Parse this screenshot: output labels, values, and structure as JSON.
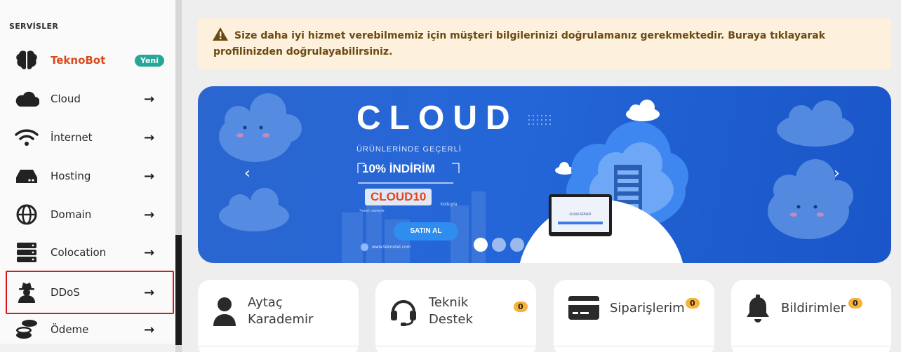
{
  "sidebar": {
    "section_title": "SERVİSLER",
    "items": [
      {
        "label": "TeknoBot",
        "badge": "Yeni",
        "icon": "brain-icon"
      },
      {
        "label": "Cloud",
        "icon": "cloud-icon"
      },
      {
        "label": "İnternet",
        "icon": "wifi-icon"
      },
      {
        "label": "Hosting",
        "icon": "server-drive-icon"
      },
      {
        "label": "Domain",
        "icon": "globe-icon"
      },
      {
        "label": "Colocation",
        "icon": "server-rack-icon"
      },
      {
        "label": "DDoS",
        "icon": "user-secret-icon"
      },
      {
        "label": "Ödeme",
        "icon": "coins-icon"
      }
    ],
    "arrow": "→"
  },
  "alert": {
    "icon": "warning-icon",
    "text": "Size daha iyi hizmet verebilmemiz için müşteri bilgilerinizi doğrulamanız gerekmektedir. Buraya tıklayarak profilinizden doğrulayabilirsiniz."
  },
  "banner": {
    "title": "CLOUD",
    "subtitle": "ÜRÜNLERİNDE GEÇERLİ",
    "discount": "10% İNDİRİM",
    "code": "CLOUD10",
    "code_note": "koduyla",
    "small_note": "*sınırlı süreyle",
    "button": "SATIN AL",
    "site": "www.teknotel.com",
    "laptop_text": "CLOUD SERVER",
    "prev": "‹",
    "next": "›"
  },
  "cards": [
    {
      "title_line1": "Aytaç",
      "title_line2": "Karademir",
      "icon": "user-icon"
    },
    {
      "title_line1": "Teknik",
      "title_line2": "Destek",
      "count": "0",
      "icon": "headset-icon"
    },
    {
      "title_line1": "Siparişlerim",
      "count": "0",
      "icon": "credit-card-icon"
    },
    {
      "title_line1": "Bildirimler",
      "count": "0",
      "icon": "bell-icon"
    }
  ]
}
